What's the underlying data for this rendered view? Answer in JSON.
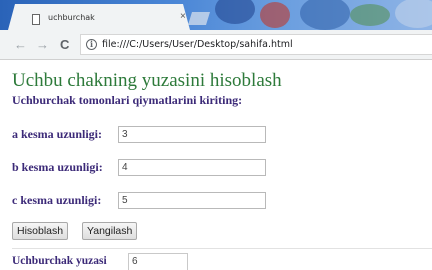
{
  "browser": {
    "tab_title": "uchburchak",
    "tab_close_glyph": "×",
    "back_glyph": "←",
    "forward_glyph": "→",
    "reload_glyph": "C",
    "info_glyph": "i",
    "url": "file:///C:/Users/User/Desktop/sahifa.html"
  },
  "page": {
    "title": "Uchbu chakning yuzasini hisoblash",
    "subtitle": "Uchburchak tomonlari qiymatlarini kiriting:"
  },
  "form": {
    "fields": [
      {
        "label": "a kesma uzunligi:",
        "value": "3"
      },
      {
        "label": "b kesma uzunligi:",
        "value": "4"
      },
      {
        "label": "c kesma uzunligi:",
        "value": "5"
      }
    ],
    "calculate_label": "Hisoblash",
    "reset_label": "Yangilash"
  },
  "result": {
    "label": "Uchburchak yuzasi",
    "value": "6"
  },
  "colors": {
    "title": "#2d7a3a",
    "labels": "#3c2a78",
    "tabstrip": "#3b74c9"
  }
}
